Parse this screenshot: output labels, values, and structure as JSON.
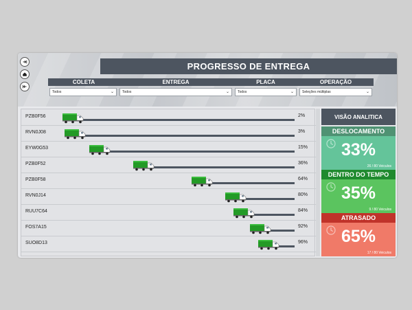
{
  "title": "PROGRESSO DE ENTREGA",
  "filters": [
    {
      "label": "COLETA",
      "value": "Todos"
    },
    {
      "label": "ENTREGA",
      "value": "Todos"
    },
    {
      "label": "PLACA",
      "value": "Todos"
    },
    {
      "label": "OPERAÇÃO",
      "value": "Seleções múltiplas"
    }
  ],
  "deliveries": [
    {
      "plate": "PZB0F56",
      "pct_label": "2%",
      "progress": 2
    },
    {
      "plate": "RVN0J08",
      "pct_label": "3%",
      "progress": 3
    },
    {
      "plate": "EYW0G53",
      "pct_label": "15%",
      "progress": 15
    },
    {
      "plate": "PZB0F52",
      "pct_label": "36%",
      "progress": 36
    },
    {
      "plate": "PZB0F58",
      "pct_label": "64%",
      "progress": 64
    },
    {
      "plate": "RVN0J14",
      "pct_label": "80%",
      "progress": 80
    },
    {
      "plate": "RUU7C64",
      "pct_label": "84%",
      "progress": 84
    },
    {
      "plate": "FOS7A15",
      "pct_label": "92%",
      "progress": 92
    },
    {
      "plate": "SUO8D13",
      "pct_label": "96%",
      "progress": 96
    }
  ],
  "vision": {
    "title": "VISÃO ANALITICA",
    "kpis": [
      {
        "label": "DESLOCAMENTO",
        "value": "33%",
        "sub": "26 / 80 Veiculos",
        "head_color": "#4f9273",
        "body_color": "#64c49a"
      },
      {
        "label": "DENTRO DO TEMPO",
        "value": "35%",
        "sub": "9 / 80 Veiculos",
        "head_color": "#1f8a2e",
        "body_color": "#5bc45f"
      },
      {
        "label": "ATRASADO",
        "value": "65%",
        "sub": "17 / 80 Veiculos",
        "head_color": "#c0332a",
        "body_color": "#f07a68"
      }
    ]
  },
  "colors": {
    "header": "#4d5560",
    "truck_cargo": "#239a26",
    "truck_cab": "#ffffff"
  }
}
